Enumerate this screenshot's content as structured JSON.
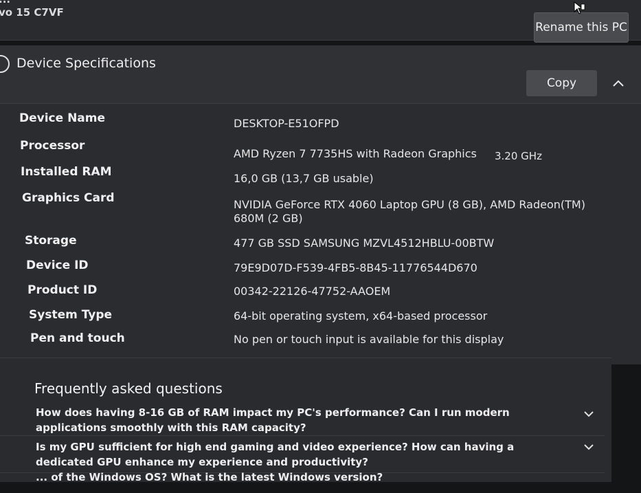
{
  "top": {
    "title": "...",
    "subtitle": "vo 15 C7VF",
    "rename_label": "Rename this PC"
  },
  "specs": {
    "title": "Device Specifications",
    "copy_label": "Copy",
    "rows": [
      {
        "label": "Device Name",
        "value": "DESKTOP-E51OFPD"
      },
      {
        "label": "Processor",
        "value": "AMD Ryzen 7 7735HS with Radeon Graphics",
        "extra": "3.20 GHz"
      },
      {
        "label": "Installed RAM",
        "value": "16,0 GB (13,7 GB usable)"
      },
      {
        "label": "Graphics Card",
        "value": "NVIDIA GeForce RTX 4060 Laptop GPU (8 GB), AMD Radeon(TM) 680M (2 GB)"
      },
      {
        "label": "Storage",
        "value": "477 GB SSD SAMSUNG MZVL4512HBLU-00BTW"
      },
      {
        "label": "Device ID",
        "value": "79E9D07D-F539-4FB5-8B45-11776544D670"
      },
      {
        "label": "Product ID",
        "value": "00342-22126-47752-AAOEM"
      },
      {
        "label": "System Type",
        "value": "64-bit operating system, x64-based processor"
      },
      {
        "label": "Pen and touch",
        "value": "No pen or touch input is available for this display"
      }
    ]
  },
  "faq": {
    "title": "Frequently asked questions",
    "items": [
      {
        "question": "How does having 8-16 GB of RAM impact my PC's performance? Can I run modern applications smoothly with this RAM capacity?"
      },
      {
        "question": "Is my GPU sufficient for high end gaming and video experience? How can having a dedicated GPU enhance my experience and productivity?"
      },
      {
        "question": "... of the Windows OS? What is the latest Windows version?"
      }
    ]
  }
}
